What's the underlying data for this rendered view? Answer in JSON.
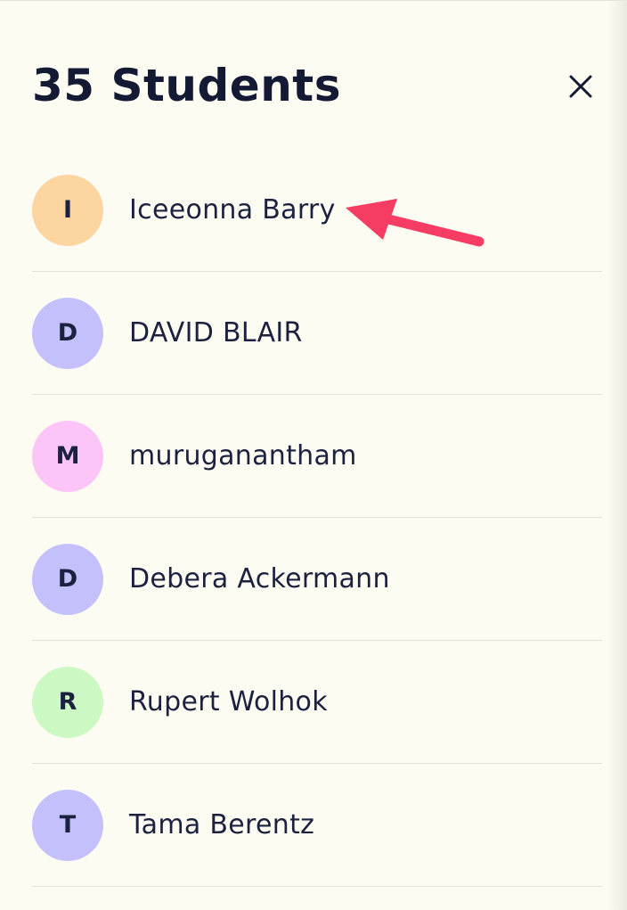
{
  "header": {
    "title": "35 Students",
    "close_icon": "close-icon"
  },
  "students": [
    {
      "initial": "I",
      "name": "Iceeonna Barry",
      "color": "#fcd5a0"
    },
    {
      "initial": "D",
      "name": "DAVID BLAIR",
      "color": "#c4c0fc"
    },
    {
      "initial": "M",
      "name": "muruganantham",
      "color": "#fcc5f7"
    },
    {
      "initial": "D",
      "name": "Debera Ackermann",
      "color": "#c4c0fc"
    },
    {
      "initial": "R",
      "name": "Rupert Wolhok",
      "color": "#ccf9c3"
    },
    {
      "initial": "T",
      "name": "Tama Berentz",
      "color": "#c4c0fc"
    }
  ],
  "annotation": {
    "icon": "arrow-icon",
    "color": "#f73c64"
  }
}
